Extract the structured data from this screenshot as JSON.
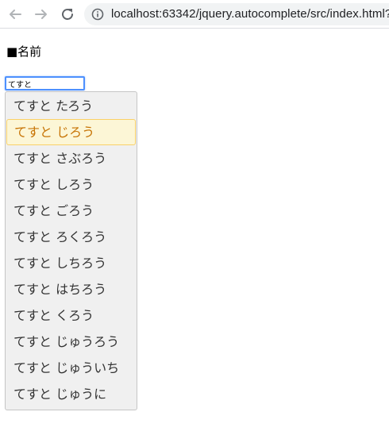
{
  "browser": {
    "url": "localhost:63342/jquery.autocomplete/src/index.html?",
    "icons": [
      "back-arrow-icon",
      "forward-arrow-icon",
      "reload-icon",
      "info-icon"
    ]
  },
  "page": {
    "label": "■名前"
  },
  "input": {
    "value": "てすと"
  },
  "colors": {
    "focus_border": "#4d90fe",
    "menu_bg": "#f0f0f0",
    "active_bg": "#fcf6d6",
    "active_border": "#fad167",
    "active_text": "#c77405"
  },
  "menu": {
    "selected_index": 1,
    "items": [
      "てすと たろう",
      "てすと じろう",
      "てすと さぶろう",
      "てすと しろう",
      "てすと ごろう",
      "てすと ろくろう",
      "てすと しちろう",
      "てすと はちろう",
      "てすと くろう",
      "てすと じゅうろう",
      "てすと じゅういち",
      "てすと じゅうに"
    ]
  }
}
